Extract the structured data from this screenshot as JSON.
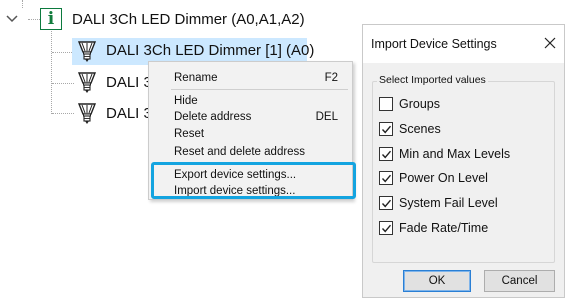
{
  "tree": {
    "root_label": "DALI 3Ch LED Dimmer (A0,A1,A2)",
    "info_icon_glyph": "i",
    "children": [
      {
        "label": "DALI 3Ch LED Dimmer [1] (A0)",
        "selected": true
      },
      {
        "label": "DALI 3"
      },
      {
        "label": "DALI 3"
      }
    ]
  },
  "context_menu": {
    "items": [
      {
        "label": "Rename",
        "shortcut": "F2"
      },
      {
        "label": "Hide",
        "shortcut": ""
      },
      {
        "label": "Delete address",
        "shortcut": "DEL"
      },
      {
        "label": "Reset",
        "shortcut": ""
      },
      {
        "label": "Reset and delete address",
        "shortcut": ""
      },
      {
        "label": "Export device settings...",
        "shortcut": ""
      },
      {
        "label": "Import device settings...",
        "shortcut": ""
      }
    ]
  },
  "dialog": {
    "title": "Import Device Settings",
    "group_label": "Select Imported values",
    "options": [
      {
        "label": "Groups",
        "checked": false
      },
      {
        "label": "Scenes",
        "checked": true
      },
      {
        "label": "Min and Max Levels",
        "checked": true
      },
      {
        "label": "Power On Level",
        "checked": true
      },
      {
        "label": "System Fail Level",
        "checked": true
      },
      {
        "label": "Fade Rate/Time",
        "checked": true
      }
    ],
    "ok_label": "OK",
    "cancel_label": "Cancel"
  },
  "colors": {
    "selection": "#cce8ff",
    "highlight_box": "#14a4e0",
    "info_icon": "#127c3d"
  }
}
